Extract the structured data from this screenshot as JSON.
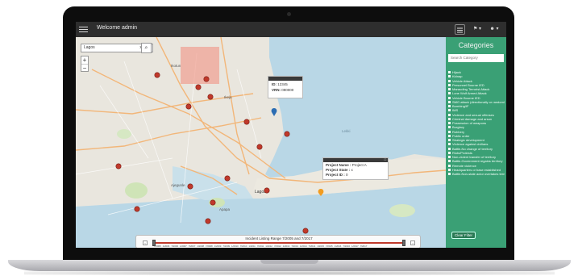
{
  "app": {
    "title": "Welcome admin"
  },
  "toolbar": {
    "notif_label": "⚑ ▾",
    "user_label": "☻ ▾"
  },
  "map": {
    "search_value": "Lagos",
    "search_clear": "×",
    "search_button_icon": "⌕",
    "zoom_in": "+",
    "zoom_out": "−",
    "places": [
      "Ikotun",
      "Ikeja",
      "Lagos",
      "Apapa",
      "Ajegunle",
      "Lekki"
    ],
    "popup1": {
      "id_label": "ID: ",
      "id_value": "12345",
      "vrn_label": "VRN: ",
      "vrn_value": "090000"
    },
    "popup2": {
      "name_label": "Project Name : ",
      "name_value": "Project A",
      "state_label": "Project State : ",
      "state_value": "x",
      "id_label": "Project ID : ",
      "id_value": "0"
    }
  },
  "slider": {
    "title": "Incident Listing Range 7/2005 and 7/2017",
    "left_arrow": "‹",
    "right_arrow": "›",
    "labels": [
      "7/2005",
      "1/2006",
      "7/2006",
      "1/2007",
      "7/2007",
      "1/2008",
      "7/2008",
      "1/2009",
      "7/2009",
      "1/2010",
      "7/2010",
      "1/2011",
      "7/2011",
      "1/2012",
      "7/2012",
      "1/2013",
      "7/2013",
      "1/2014",
      "7/2014",
      "1/2015",
      "7/2015",
      "1/2016",
      "7/2016",
      "1/2017",
      "7/2017"
    ]
  },
  "panel": {
    "title": "Categories",
    "search_placeholder": "Search Category",
    "categories": [
      "Hijack",
      "Kidnap",
      "Vehicle Attack",
      "Personnel Bourne IED",
      "Marauding Terrorist Attack",
      "Lone Wolf Armed Attack",
      "Vehicle Bourne IED",
      "SMG attack (directionally or randomly disbursed persons)",
      "Bombing/IF",
      "IMS",
      "Violence and sexual offenses",
      "Criminal damage and arson",
      "Possession of weapons",
      "Burglary",
      "Robbery",
      "Public order",
      "Strategic development",
      "Violence against civilians",
      "Battle-No change of territory",
      "Riots/Protests",
      "Non-violent transfer of territory",
      "Battle-Government regains territory",
      "Remote violence",
      "Headquarters or base established",
      "Battle-Non-state actor overtakes territory"
    ],
    "clear_button": "Clear Filter"
  },
  "colors": {
    "panel_bg": "#3aa075",
    "marker": "#c0392b",
    "water": "#b9d7e6",
    "topbar": "#2e2e2e"
  }
}
